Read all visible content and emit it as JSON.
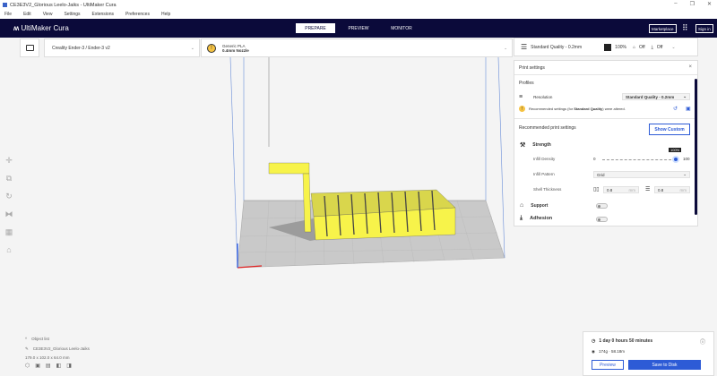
{
  "window": {
    "title": "CE3E3V2_Glorious Leelo-Jaiks - UltiMaker Cura",
    "controls": [
      "–",
      "❐",
      "✕"
    ]
  },
  "menu": [
    "File",
    "Edit",
    "View",
    "Settings",
    "Extensions",
    "Preferences",
    "Help"
  ],
  "header": {
    "logo": "UltiMaker Cura",
    "tabs": [
      "PREPARE",
      "PREVIEW",
      "MONITOR"
    ],
    "active_tab": "PREPARE",
    "marketplace": "Marketplace",
    "sign_in": "Sign in"
  },
  "toolbar": {
    "printer": "Creality Ender-3 / Ender-3 v2",
    "material": "Generic PLA",
    "nozzle": "0.4mm Nozzle",
    "profile": "Standard Quality - 0.2mm",
    "infill": "100%",
    "support": "Off",
    "adhesion": "Off"
  },
  "print_settings": {
    "title": "Print settings",
    "profiles_label": "Profiles",
    "resolution_label": "Resolution",
    "resolution_value": "Standard Quality - 0.2mm",
    "warning_pre": "Recommended settings (for ",
    "warning_bold": "Standard Quality",
    "warning_post": ") were altered.",
    "recommended_label": "Recommended print settings",
    "show_custom": "Show Custom",
    "strength": "Strength",
    "infill_density_label": "Infill Density",
    "slider_min": "0",
    "slider_max": "100",
    "slider_value_label": "100%",
    "infill_density_percent": 100,
    "infill_pattern_label": "Infill Pattern",
    "infill_pattern_value": "Grid",
    "shell_label": "Shell Thickness",
    "wall_value": "0.8",
    "top_bottom_value": "0.8",
    "unit": "mm",
    "support": "Support",
    "adhesion": "Adhesion",
    "support_on": false,
    "adhesion_on": false
  },
  "object_list": {
    "label": "Object list",
    "object_name": "CE3E3V2_Glorious Leelo-Jaiks",
    "dimensions": "179.0 x 102.0 x 64.0 mm"
  },
  "action": {
    "time": "1 day 0 hours 50 minutes",
    "material": "174g · 58.18m",
    "preview": "Preview",
    "save": "Save to Disk"
  },
  "colors": {
    "header": "#0b0a3a",
    "accent": "#2d5bd6",
    "model": "#f7f34a",
    "plate": "#c8c8c8"
  }
}
